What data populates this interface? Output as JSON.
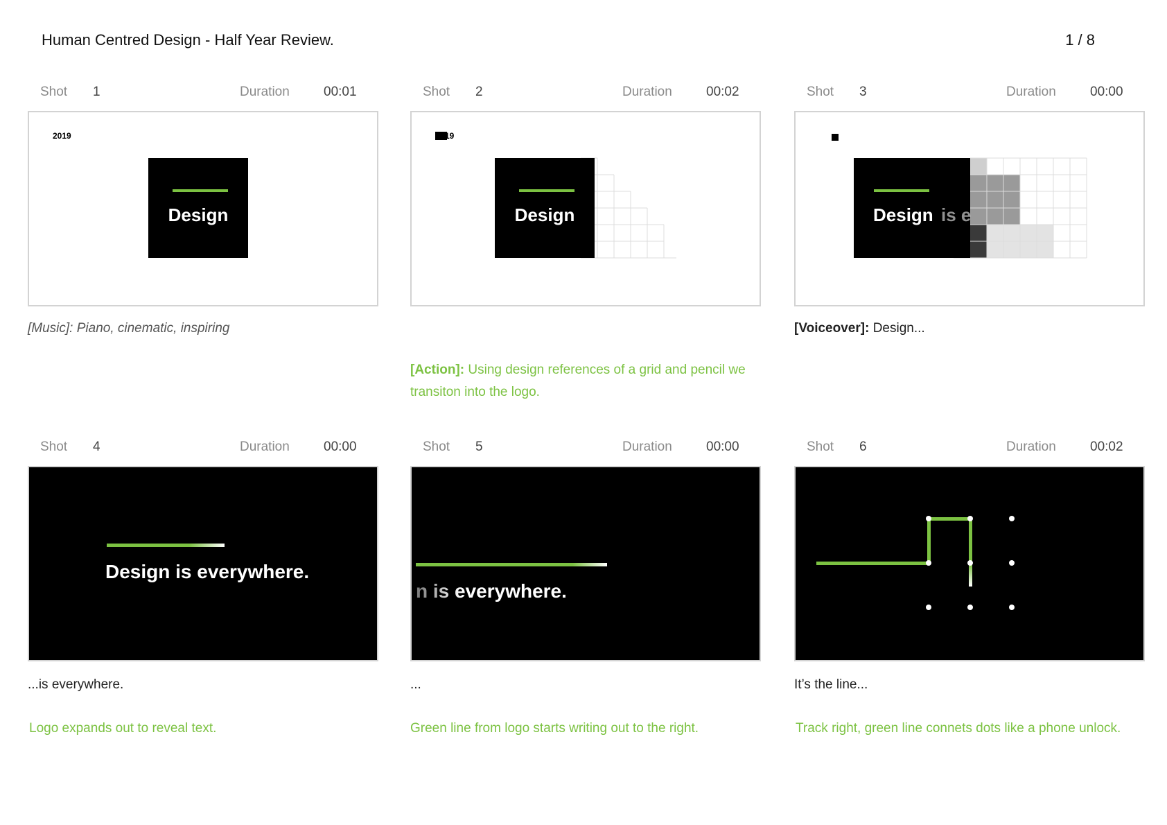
{
  "header": {
    "title": "Human Centred Design - Half Year Review.",
    "page": "1 / 8"
  },
  "labels": {
    "shot": "Shot",
    "duration": "Duration"
  },
  "colors": {
    "accent_green": "#7cc242",
    "black": "#000000",
    "frame_border": "#d3d3d3"
  },
  "shots": [
    {
      "number": "1",
      "duration": "00:01",
      "frame_text": {
        "year": "2019",
        "logo": "Design"
      },
      "notes": {
        "music_label": "[Music]:",
        "music": "Piano, cinematic, inspiring"
      }
    },
    {
      "number": "2",
      "duration": "00:02",
      "frame_text": {
        "year": "19",
        "logo": "Design"
      },
      "notes": {
        "action_label": "[Action]:",
        "action": "Using design references of  a grid and pencil we transiton into the logo."
      }
    },
    {
      "number": "3",
      "duration": "00:00",
      "frame_text": {
        "logo": "Design",
        "partial": "is e"
      },
      "notes": {
        "voiceover_label": "[Voiceover]:",
        "voiceover": "Design..."
      }
    },
    {
      "number": "4",
      "duration": "00:00",
      "frame_text": {
        "headline": "Design is everywhere."
      },
      "notes": {
        "line1": "...is everywhere.",
        "line2": "Logo expands out to reveal text."
      }
    },
    {
      "number": "5",
      "duration": "00:00",
      "frame_text": {
        "headline": "n is everywhere."
      },
      "notes": {
        "line1": "...",
        "line2": "Green line from logo starts writing out to the right."
      }
    },
    {
      "number": "6",
      "duration": "00:02",
      "frame_text": {},
      "notes": {
        "line1": "It’s the line...",
        "line2": "Track right, green line connets dots like a phone unlock."
      }
    }
  ]
}
